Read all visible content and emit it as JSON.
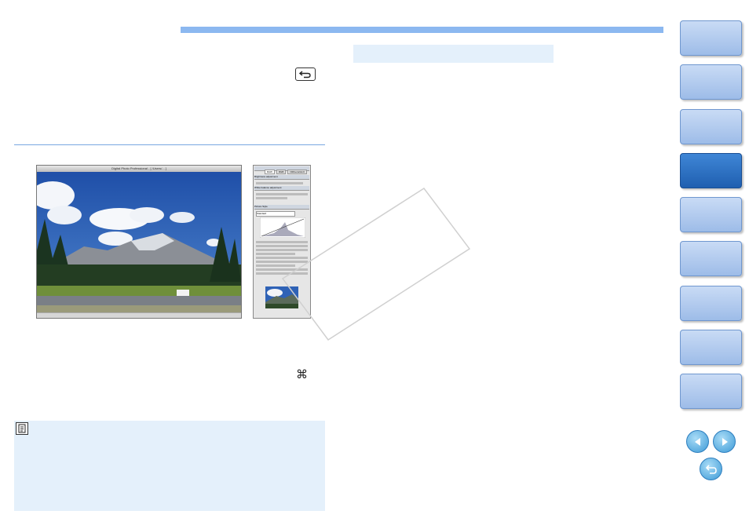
{
  "screenshot_main": {
    "title_text": "Digital Photo Professional - [ /Users/... ]"
  },
  "palette": {
    "tabs": [
      "RAW",
      "RGB",
      "NR/Lens/ALO"
    ],
    "sections": [
      "Brightness adjustment",
      "White balance adjustment",
      "Picture Style"
    ],
    "picture_style_value": "Standard"
  },
  "icons": {
    "undo_key": "return-arrow-icon",
    "command_key": "⌘",
    "memo": "memo-icon",
    "prev": "prev-page-icon",
    "next": "next-page-icon",
    "back": "back-icon"
  },
  "nav": {
    "tabs": [
      "",
      "",
      "",
      "",
      "",
      "",
      "",
      "",
      ""
    ],
    "active_index": 3
  },
  "colors": {
    "accent": "#8cb8f0",
    "light_panel": "#e4f0fb",
    "active_tab": "#2469bd"
  }
}
